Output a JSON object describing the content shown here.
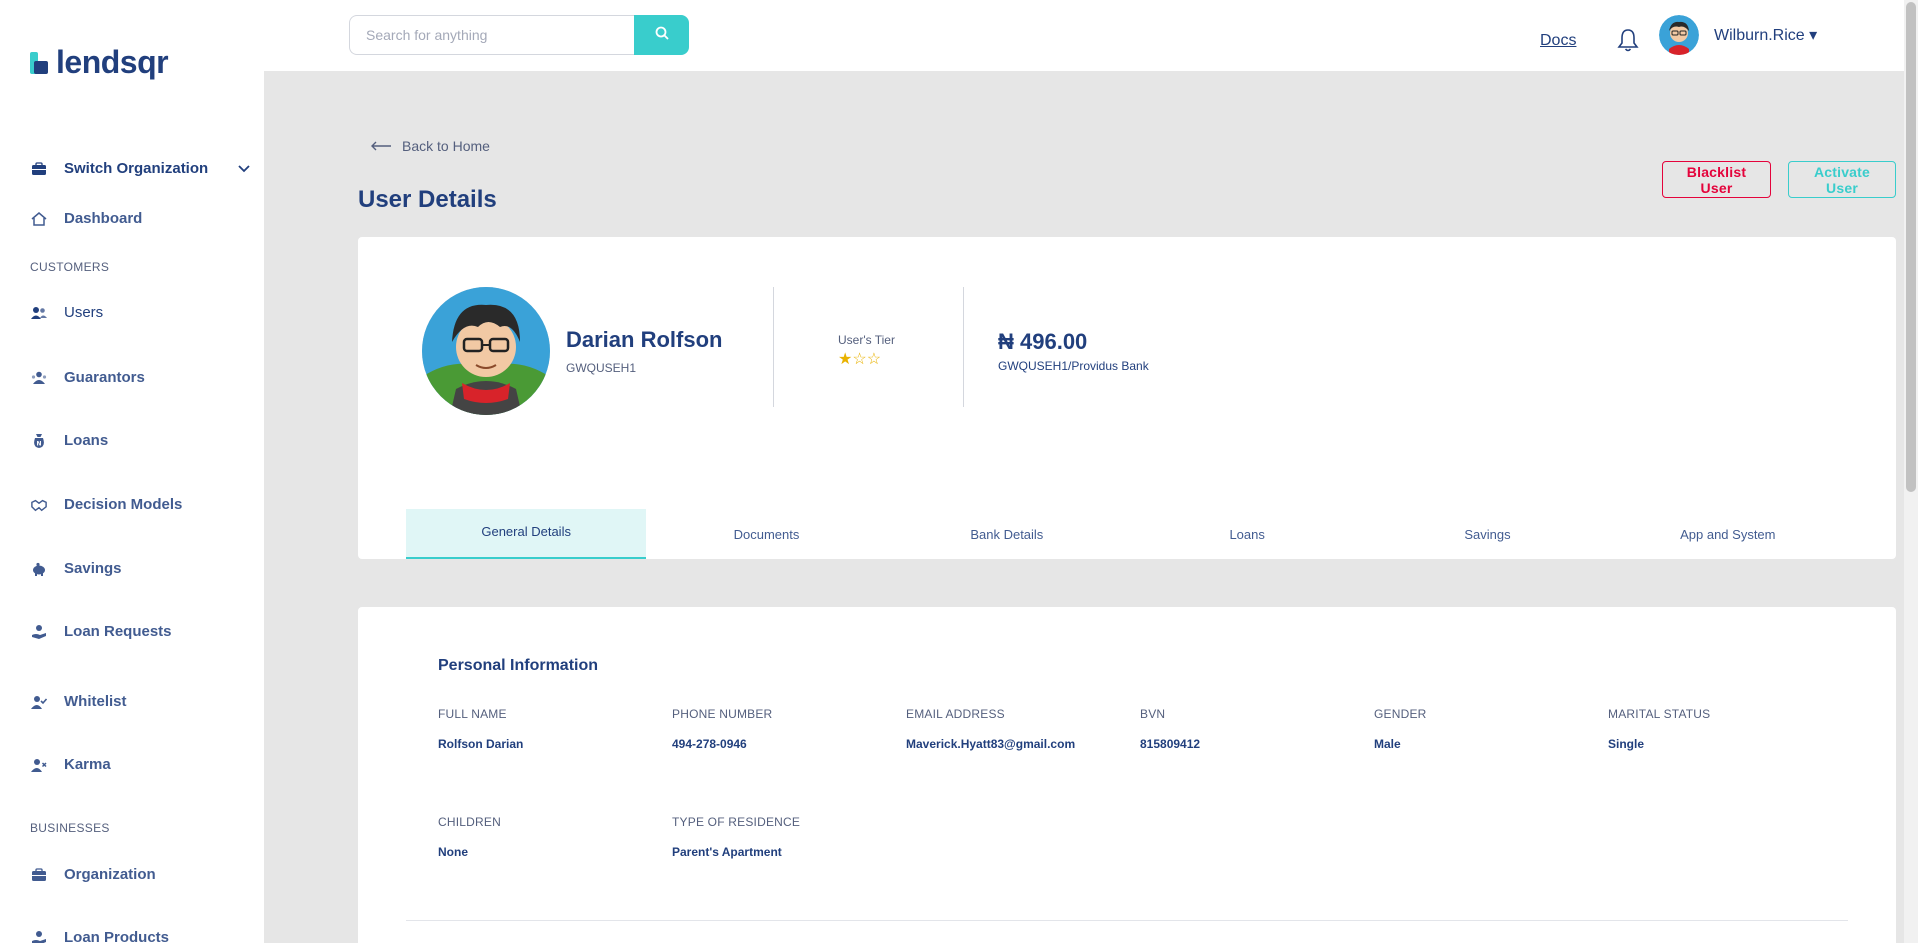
{
  "brand": {
    "name": "lendsqr"
  },
  "sidebar": {
    "switch_org": "Switch Organization",
    "dashboard": "Dashboard",
    "section_customers": "CUSTOMERS",
    "customers": [
      "Users",
      "Guarantors",
      "Loans",
      "Decision Models",
      "Savings",
      "Loan Requests",
      "Whitelist",
      "Karma"
    ],
    "section_businesses": "BUSINESSES",
    "businesses": [
      "Organization",
      "Loan Products"
    ]
  },
  "header": {
    "search_placeholder": "Search for anything",
    "docs": "Docs",
    "username": "Wilburn.Rice ▾"
  },
  "page": {
    "back": "Back to Home",
    "title": "User Details",
    "blacklist_btn": "Blacklist User",
    "activate_btn": "Activate User"
  },
  "profile": {
    "name": "Darian Rolfson",
    "code": "GWQUSEH1",
    "tier_label": "User's Tier",
    "tier_rating": 1,
    "tier_stars": "★☆☆",
    "balance": "₦ 496.00",
    "bank": "GWQUSEH1/Providus Bank"
  },
  "tabs": [
    "General Details",
    "Documents",
    "Bank Details",
    "Loans",
    "Savings",
    "App and System"
  ],
  "personal": {
    "title": "Personal Information",
    "fields": [
      {
        "label": "FULL NAME",
        "value": "Rolfson Darian"
      },
      {
        "label": "PHONE NUMBER",
        "value": "494-278-0946"
      },
      {
        "label": "EMAIL ADDRESS",
        "value": "Maverick.Hyatt83@gmail.com"
      },
      {
        "label": "BVN",
        "value": "815809412"
      },
      {
        "label": "GENDER",
        "value": "Male"
      },
      {
        "label": "MARITAL STATUS",
        "value": "Single"
      },
      {
        "label": "CHILDREN",
        "value": "None"
      },
      {
        "label": "TYPE OF RESIDENCE",
        "value": "Parent's Apartment"
      }
    ]
  },
  "colors": {
    "primary": "#213f7d",
    "accent": "#39cdcc",
    "danger": "#e4033b",
    "star": "#e9b200"
  }
}
